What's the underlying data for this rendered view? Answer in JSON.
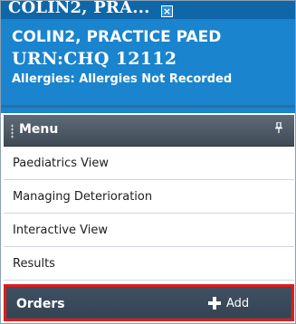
{
  "tab": {
    "title": "COLIN2, PRA...",
    "close_glyph": "×"
  },
  "patient": {
    "name": "COLIN2, PRACTICE PAED",
    "urn": "URN:CHQ 12112",
    "allergies": "Allergies: Allergies Not Recorded"
  },
  "menu": {
    "title": "Menu",
    "pin_icon": "pin-icon",
    "items": [
      {
        "label": "Paediatrics View"
      },
      {
        "label": "Managing Deterioration"
      },
      {
        "label": "Interactive View"
      },
      {
        "label": "Results"
      }
    ]
  },
  "orders": {
    "label": "Orders",
    "add_label": "Add",
    "highlight_color": "#e01b1b"
  },
  "colors": {
    "banner": "#1a84ce",
    "menu_header": "#4b5763",
    "orders_bar": "#3d4c5a"
  }
}
